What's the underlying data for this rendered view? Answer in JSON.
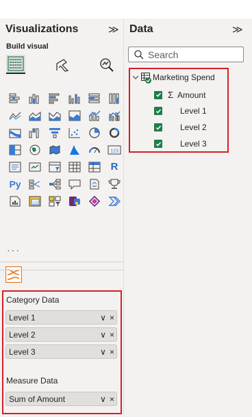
{
  "visualizations": {
    "title": "Visualizations",
    "collapse_glyph": "≫",
    "build_visual_label": "Build visual",
    "build_buttons": [
      {
        "name": "build-visual-icon",
        "active": true
      },
      {
        "name": "format-visual-icon",
        "active": false
      },
      {
        "name": "analytics-icon",
        "active": false
      }
    ],
    "visual_icons": [
      "stacked-bar-chart-icon",
      "stacked-column-chart-icon",
      "clustered-bar-chart-icon",
      "clustered-column-chart-icon",
      "100-stacked-bar-chart-icon",
      "100-stacked-column-chart-icon",
      "line-chart-icon",
      "area-chart-icon",
      "stacked-area-chart-icon",
      "100-stacked-area-chart-icon",
      "line-stacked-column-chart-icon",
      "line-clustered-column-chart-icon",
      "ribbon-chart-icon",
      "waterfall-chart-icon",
      "funnel-chart-icon",
      "scatter-chart-icon",
      "pie-chart-icon",
      "donut-chart-icon",
      "treemap-icon",
      "map-icon",
      "filled-map-icon",
      "azure-map-icon",
      "gauge-icon",
      "card-icon",
      "multi-row-card-icon",
      "kpi-icon",
      "slicer-icon",
      "table-icon",
      "matrix-icon",
      "r-visual-icon",
      "python-visual-icon",
      "key-influencers-icon",
      "decomposition-tree-icon",
      "qa-icon",
      "smart-narrative-icon",
      "goals-icon",
      "paginated-report-icon",
      "new-card-icon",
      "button-slicer-icon",
      "power-apps-icon",
      "power-automate-icon",
      "arrow-chevron-icon"
    ],
    "card_text": "123",
    "r_text": "R",
    "py_text": "Py",
    "more_label": "···",
    "custom_visual": "sankey-custom-visual-icon",
    "wells": [
      {
        "title": "Category Data",
        "fields": [
          "Level 1",
          "Level 2",
          "Level 3"
        ]
      },
      {
        "title": "Measure Data",
        "fields": [
          "Sum of Amount"
        ]
      }
    ],
    "pill_dropdown_glyph": "∨",
    "pill_remove_glyph": "×"
  },
  "data_pane": {
    "title": "Data",
    "collapse_glyph": "≫",
    "search_placeholder": "Search",
    "table": {
      "name": "Marketing Spend",
      "expanded": true,
      "fields": [
        {
          "label": "Amount",
          "sigma": "Σ",
          "checked": true
        },
        {
          "label": "Level 1",
          "checked": true
        },
        {
          "label": "Level 2",
          "checked": true
        },
        {
          "label": "Level 3",
          "checked": true
        }
      ]
    }
  },
  "colors": {
    "highlight": "#d31f26",
    "check_green": "#1f7d4a",
    "pane_bg": "#f3f2f1",
    "pill_bg": "#e1dfdd"
  }
}
